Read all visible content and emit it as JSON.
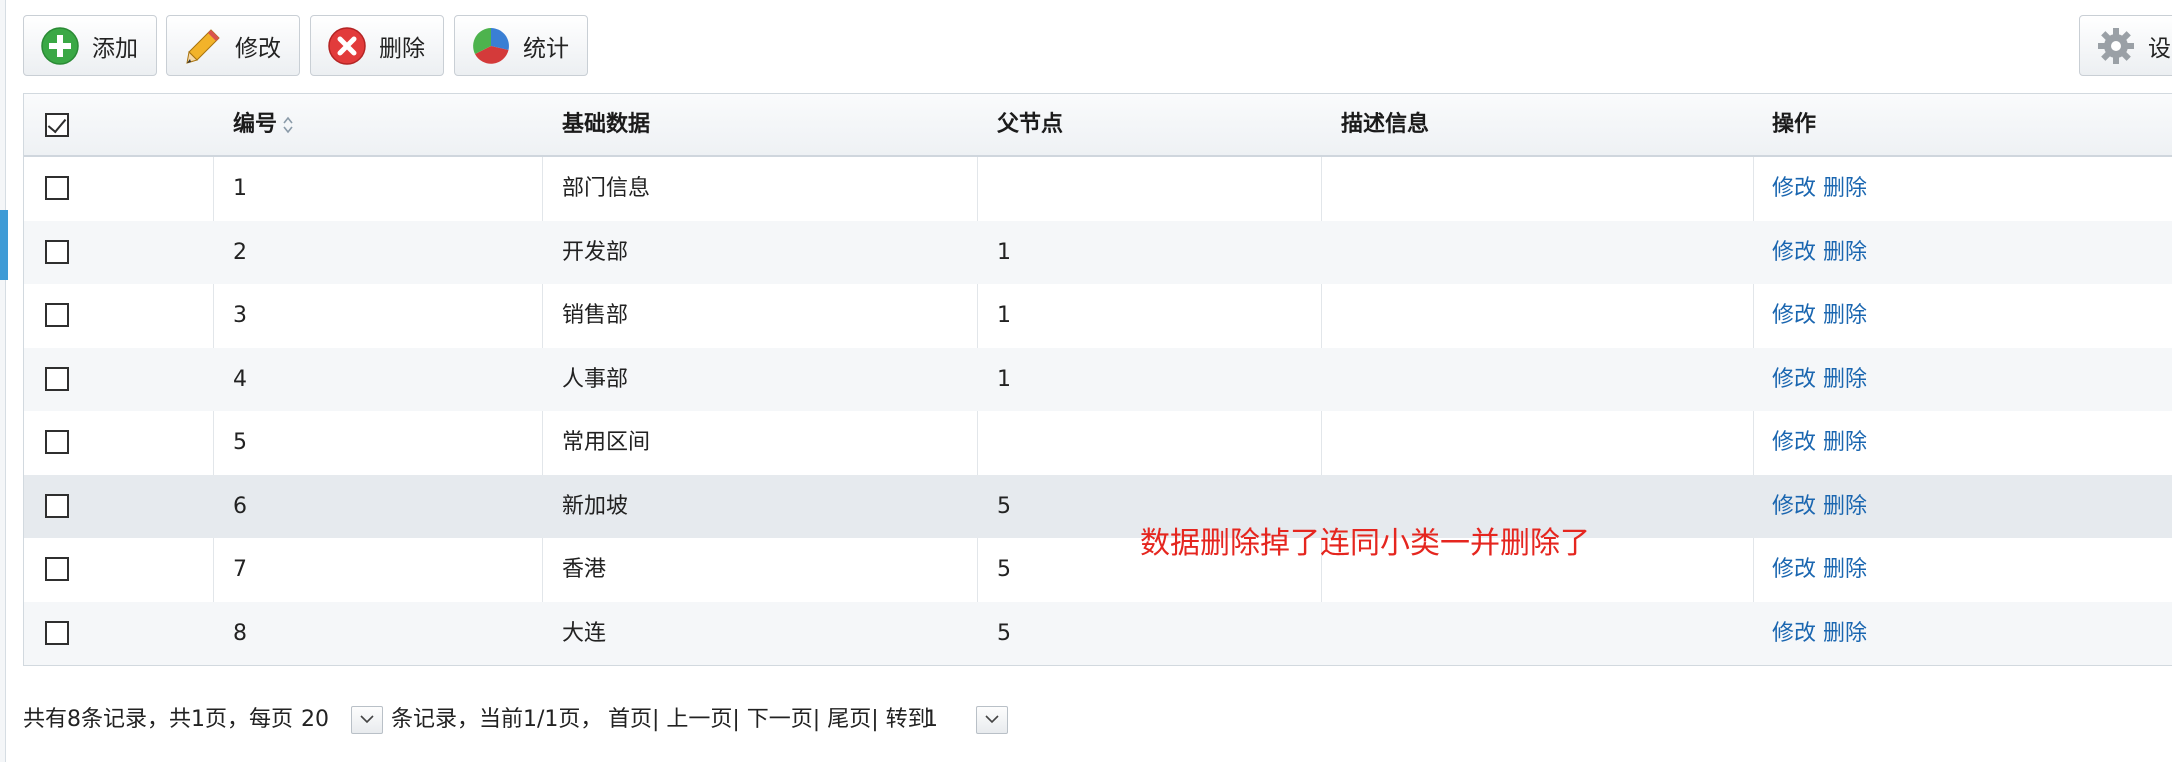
{
  "toolbar": {
    "add_label": "添加",
    "edit_label": "修改",
    "delete_label": "删除",
    "stats_label": "统计",
    "settings_label": "设"
  },
  "table": {
    "columns": [
      "编号",
      "基础数据",
      "父节点",
      "描述信息",
      "操作"
    ],
    "rows": [
      {
        "id": "1",
        "name": "部门信息",
        "parent": "",
        "desc": "",
        "edit": "修改",
        "delete": "删除"
      },
      {
        "id": "2",
        "name": "开发部",
        "parent": "1",
        "desc": "",
        "edit": "修改",
        "delete": "删除"
      },
      {
        "id": "3",
        "name": "销售部",
        "parent": "1",
        "desc": "",
        "edit": "修改",
        "delete": "删除"
      },
      {
        "id": "4",
        "name": "人事部",
        "parent": "1",
        "desc": "",
        "edit": "修改",
        "delete": "删除"
      },
      {
        "id": "5",
        "name": "常用区间",
        "parent": "",
        "desc": "",
        "edit": "修改",
        "delete": "删除"
      },
      {
        "id": "6",
        "name": "新加坡",
        "parent": "5",
        "desc": "",
        "edit": "修改",
        "delete": "删除"
      },
      {
        "id": "7",
        "name": "香港",
        "parent": "5",
        "desc": "",
        "edit": "修改",
        "delete": "删除"
      },
      {
        "id": "8",
        "name": "大连",
        "parent": "5",
        "desc": "",
        "edit": "修改",
        "delete": "删除"
      }
    ]
  },
  "annotation": "数据删除掉了连同小类一并删除了",
  "pager": {
    "summary": "共有8条记录，共1页，每页",
    "page_size": "20",
    "records_current": "条记录，当前1/1页，",
    "links": "首页| 上一页| 下一页| 尾页| 转到",
    "goto_page": "1"
  },
  "colors": {
    "link": "#1a66b0",
    "annotation": "#e5261f",
    "accent": "#3f9bd6"
  }
}
